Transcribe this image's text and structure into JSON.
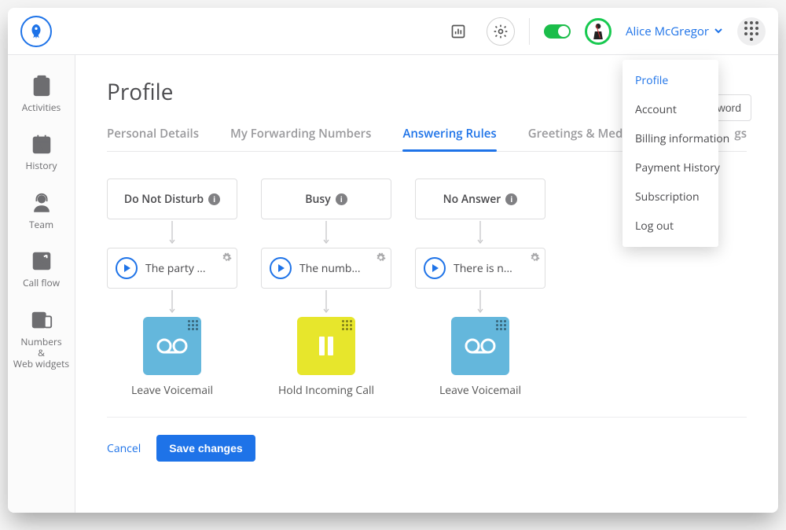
{
  "header": {
    "user_name": "Alice McGregor",
    "dropdown": [
      "Profile",
      "Account",
      "Billing information",
      "Payment History",
      "Subscription",
      "Log out"
    ],
    "dropdown_selected": 0
  },
  "sidebar": [
    {
      "icon": "activities",
      "label": "Activities"
    },
    {
      "icon": "history",
      "label": "History"
    },
    {
      "icon": "team",
      "label": "Team"
    },
    {
      "icon": "callflow",
      "label": "Call flow"
    },
    {
      "icon": "numbers",
      "label": "Numbers\n&\nWeb widgets"
    }
  ],
  "page": {
    "title": "Profile",
    "password_btn": "ssword",
    "tabs": [
      "Personal Details",
      "My Forwarding Numbers",
      "Answering Rules",
      "Greetings & Media",
      "gs"
    ],
    "active_tab": 2
  },
  "rules": [
    {
      "head": "Do Not Disturb",
      "greeting": "The party ...",
      "action": "voicemail",
      "action_label": "Leave Voicemail"
    },
    {
      "head": "Busy",
      "greeting": "The numb...",
      "action": "hold",
      "action_label": "Hold Incoming Call"
    },
    {
      "head": "No Answer",
      "greeting": "There is n...",
      "action": "voicemail",
      "action_label": "Leave Voicemail"
    }
  ],
  "buttons": {
    "cancel": "Cancel",
    "save": "Save changes"
  }
}
